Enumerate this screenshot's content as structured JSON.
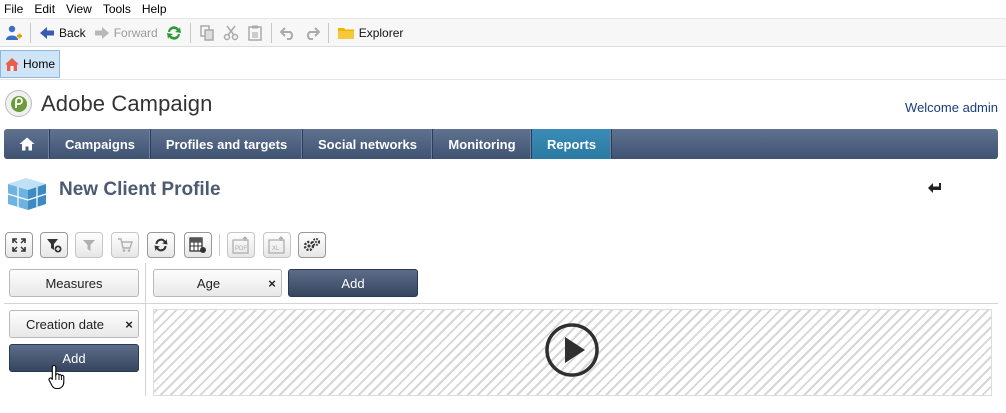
{
  "menu": [
    "File",
    "Edit",
    "View",
    "Tools",
    "Help"
  ],
  "toolbar": {
    "back": "Back",
    "forward": "Forward",
    "explorer": "Explorer"
  },
  "tabs": {
    "home": "Home"
  },
  "brand": {
    "name": "Adobe Campaign"
  },
  "welcome": "Welcome admin",
  "nav": {
    "items": [
      "Campaigns",
      "Profiles and targets",
      "Social networks",
      "Monitoring",
      "Reports"
    ],
    "active": "Reports"
  },
  "page": {
    "title": "New Client Profile"
  },
  "pivot": {
    "measures_label": "Measures",
    "column_dimension": "Age",
    "column_add": "Add",
    "row_dimension": "Creation date",
    "row_add": "Add"
  },
  "colors": {
    "nav_bg": "#4a5c7b",
    "nav_active": "#2f82ad",
    "title": "#4c5b70",
    "welcome": "#1a3d7c"
  }
}
